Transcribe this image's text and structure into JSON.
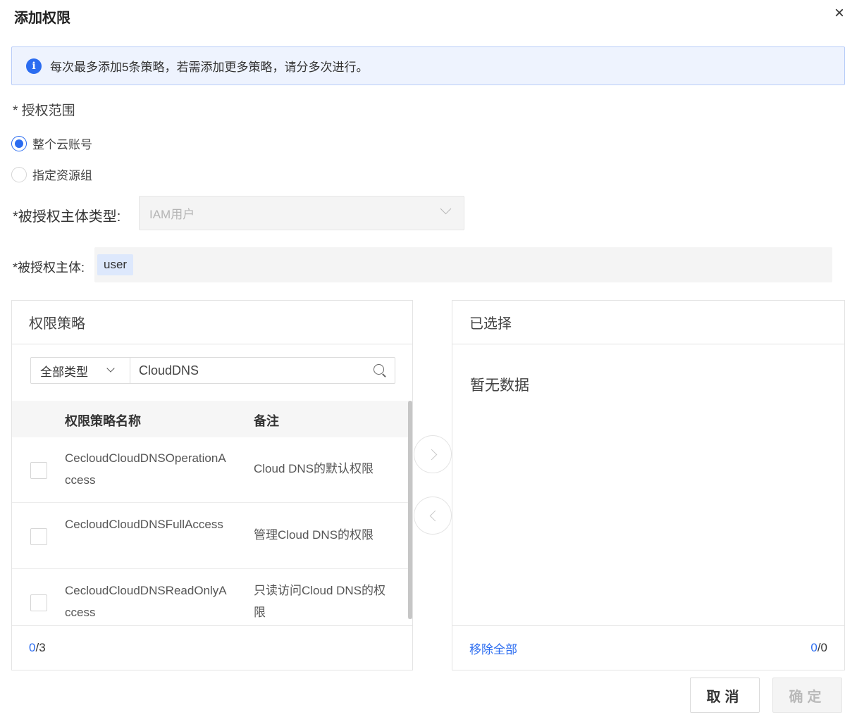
{
  "dialog": {
    "title": "添加权限",
    "close_label": "×"
  },
  "notice": {
    "icon": "info-icon",
    "text": "每次最多添加5条策略，若需添加更多策略，请分多次进行。"
  },
  "scope": {
    "label": "* 授权范围",
    "options": [
      {
        "label": "整个云账号",
        "checked": true
      },
      {
        "label": "指定资源组",
        "checked": false
      }
    ]
  },
  "subject_type": {
    "label": "*被授权主体类型:",
    "value": "IAM用户"
  },
  "subject": {
    "label": "*被授权主体:",
    "tag": "user"
  },
  "left_panel": {
    "title": "权限策略",
    "type_filter": "全部类型",
    "search_value": "CloudDNS",
    "columns": {
      "name": "权限策略名称",
      "note": "备注"
    },
    "rows": [
      {
        "name": "CecloudCloudDNSOperationAccess",
        "note": "Cloud DNS的默认权限"
      },
      {
        "name": "CecloudCloudDNSFullAccess",
        "note": "管理Cloud DNS的权限"
      },
      {
        "name": "CecloudCloudDNSReadOnlyAccess",
        "note": "只读访问Cloud DNS的权限"
      }
    ],
    "count_selected": "0",
    "count_total": "/3"
  },
  "right_panel": {
    "title": "已选择",
    "empty_text": "暂无数据",
    "remove_all": "移除全部",
    "count_selected": "0",
    "count_total": "/0"
  },
  "footer": {
    "cancel_label": "取消",
    "ok_label": "确定"
  },
  "colors": {
    "accent": "#2b6cf0",
    "notice_bg": "#eef3fe",
    "disabled_bg": "#f4f4f4"
  }
}
